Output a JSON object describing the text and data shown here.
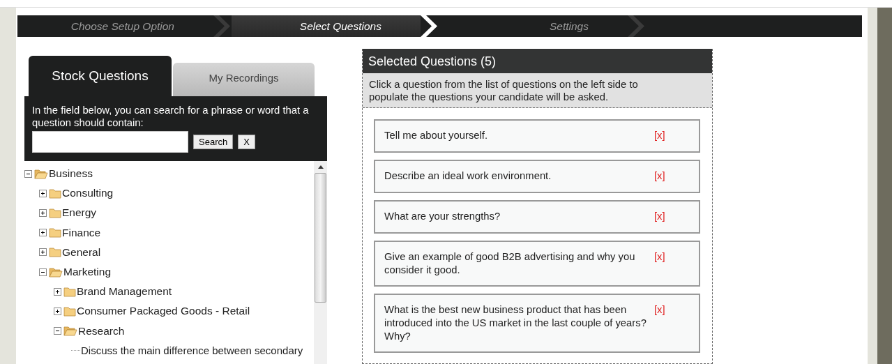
{
  "steps": [
    {
      "label": "Choose Setup Option",
      "selected": false
    },
    {
      "label": "Select Questions",
      "selected": true
    },
    {
      "label": "Settings",
      "selected": false
    }
  ],
  "tabs": [
    {
      "label": "Stock Questions",
      "selected": true
    },
    {
      "label": "My Recordings",
      "selected": false
    }
  ],
  "search": {
    "hint": "In the field below, you can search for a phrase or word that a question should contain:",
    "button": "Search",
    "clear": "X"
  },
  "tree": [
    {
      "label": "Business",
      "expanded": true,
      "children": [
        {
          "label": "Consulting",
          "expanded": false
        },
        {
          "label": "Energy",
          "expanded": false
        },
        {
          "label": "Finance",
          "expanded": false
        },
        {
          "label": "General",
          "expanded": false
        },
        {
          "label": "Marketing",
          "expanded": true,
          "children": [
            {
              "label": "Brand Management",
              "expanded": false
            },
            {
              "label": "Consumer Packaged Goods - Retail",
              "expanded": false
            },
            {
              "label": "Research",
              "expanded": true,
              "children": [
                {
                  "label": "Discuss the main difference between secondary",
                  "kind": "question"
                }
              ]
            }
          ]
        }
      ]
    }
  ],
  "selected": {
    "title": "Selected Questions (5)",
    "instructions": "Click a question from the list of questions on the left side to populate the questions your candidate will be asked.",
    "questions": [
      {
        "text": "Tell me about yourself.",
        "remove": "[x]"
      },
      {
        "text": "Describe an ideal work environment.",
        "remove": "[x]"
      },
      {
        "text": "What are your strengths?",
        "remove": "[x]"
      },
      {
        "text": "Give an example of good B2B advertising and why you consider it good.",
        "remove": "[x]"
      },
      {
        "text": "What is the best new business product that has been introduced into the US market in the last couple of years? Why?",
        "remove": "[x]"
      }
    ]
  }
}
